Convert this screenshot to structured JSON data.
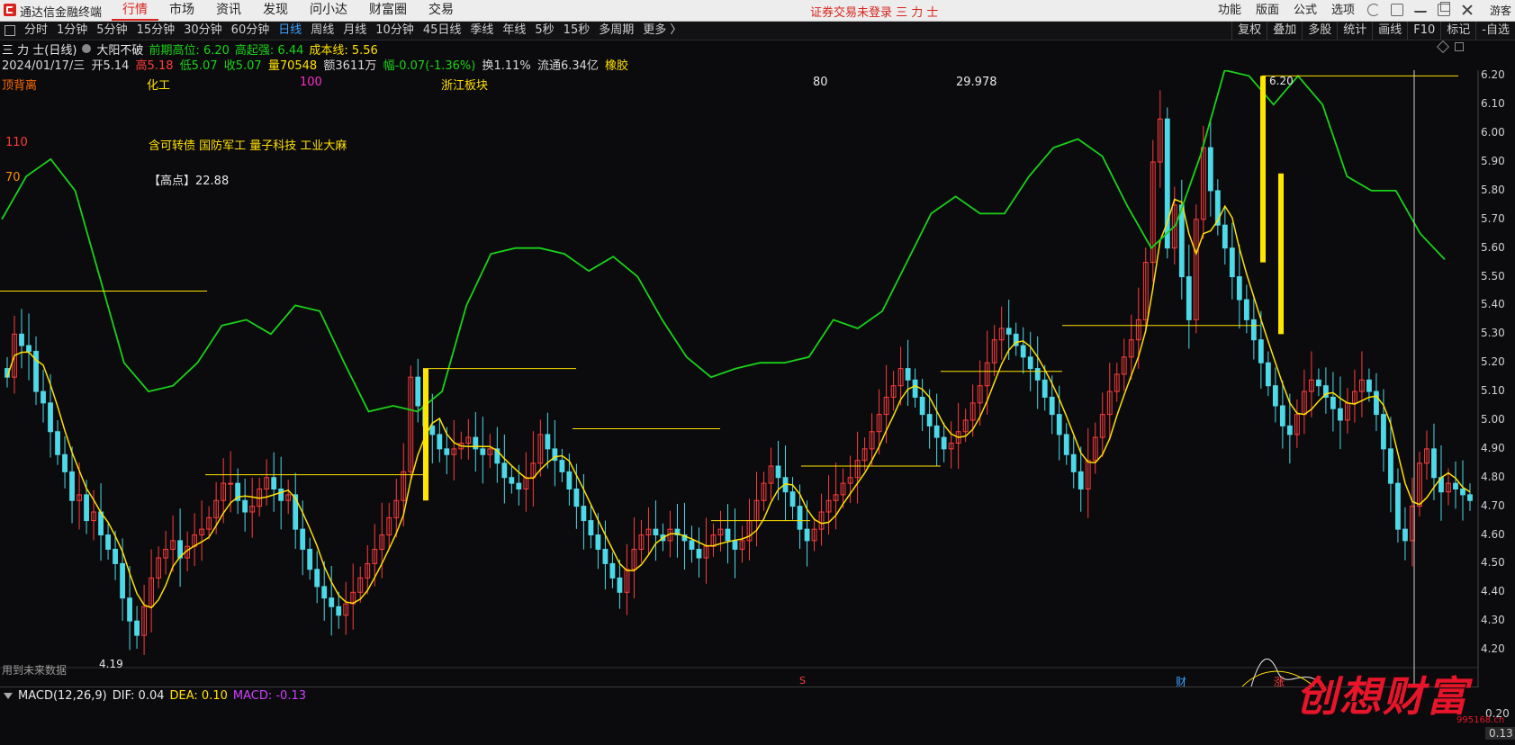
{
  "app": {
    "title": "通达信金融终端"
  },
  "menu": [
    "行情",
    "市场",
    "资讯",
    "发现",
    "问小达",
    "财富圈",
    "交易"
  ],
  "login_status": "证券交易未登录  三 力 士",
  "right_menu": [
    "功能",
    "版面",
    "公式",
    "选项"
  ],
  "guest_label": "游客",
  "periods": [
    "分时",
    "1分钟",
    "5分钟",
    "15分钟",
    "30分钟",
    "60分钟",
    "日线",
    "周线",
    "月线",
    "10分钟",
    "45日线",
    "季线",
    "年线",
    "5秒",
    "15秒",
    "多周期",
    "更多 〉"
  ],
  "active_period": "日线",
  "tools": [
    "复权",
    "叠加",
    "多股",
    "统计",
    "画线",
    "F10",
    "标记",
    "-自选"
  ],
  "stock": {
    "name": "三 力 士(日线)",
    "indicator": "大阳不破",
    "prev_high": "前期高位: 6.20",
    "strong": "高起强: 6.44",
    "cost": "成本线: 5.56"
  },
  "ohlc": {
    "date": "2024/01/17/三",
    "open": "开5.14",
    "high": "高5.18",
    "low": "低5.07",
    "close": "收5.07",
    "vol": "量70548",
    "amount": "额3611万",
    "change": "幅-0.07(-1.36%)",
    "turnover": "换1.11%",
    "float": "流通6.34亿",
    "sector": "橡胶"
  },
  "labels": {
    "top_div": "顶背离",
    "industry": "化工",
    "v100": "100",
    "region": "浙江板块",
    "v80": "80",
    "v29": "29.978",
    "v110": "110",
    "concepts": "含可转债  国防军工  量子科技  工业大麻",
    "v70": "70",
    "highpoint": "【高点】22.88",
    "future_data": "用到未来数据",
    "high_mark": "6.20",
    "low_mark": "4.19",
    "marker_s": "S",
    "marker_cai": "财",
    "marker_zhang": "涨"
  },
  "price_axis": [
    "6.20",
    "6.10",
    "6.00",
    "5.90",
    "5.80",
    "5.70",
    "5.60",
    "5.50",
    "5.40",
    "5.30",
    "5.20",
    "5.10",
    "5.00",
    "4.90",
    "4.80",
    "4.70",
    "4.60",
    "4.50",
    "4.40",
    "4.30",
    "4.20"
  ],
  "macd": {
    "name": "MACD(12,26,9)",
    "dif": "DIF: 0.04",
    "dea": "DEA: 0.10",
    "macd": "MACD: -0.13",
    "axis": [
      "0.20",
      "0.13"
    ]
  },
  "watermark": {
    "text": "创想财富",
    "url": "995168.cn"
  },
  "colors": {
    "up": "#ff3c3c",
    "down": "#4dd9e8",
    "ma": "#ffe000",
    "band": "#19d219",
    "hline": "#ffe000"
  },
  "chart_data": {
    "type": "candlestick",
    "ylim": [
      4.15,
      6.22
    ],
    "n_bars": 200,
    "close": [
      5.15,
      5.3,
      5.26,
      5.24,
      5.1,
      5.06,
      4.96,
      4.88,
      4.82,
      4.72,
      4.74,
      4.65,
      4.68,
      4.6,
      4.55,
      4.5,
      4.38,
      4.3,
      4.25,
      4.35,
      4.45,
      4.52,
      4.55,
      4.58,
      4.52,
      4.56,
      4.6,
      4.62,
      4.66,
      4.72,
      4.78,
      4.78,
      4.72,
      4.68,
      4.7,
      4.76,
      4.8,
      4.76,
      4.72,
      4.74,
      4.62,
      4.55,
      4.48,
      4.42,
      4.38,
      4.35,
      4.32,
      4.36,
      4.4,
      4.45,
      4.5,
      4.55,
      4.6,
      4.66,
      4.72,
      4.82,
      5.15,
      5.05,
      4.98,
      4.95,
      4.9,
      4.88,
      4.9,
      4.92,
      4.94,
      4.9,
      4.88,
      4.9,
      4.85,
      4.8,
      4.78,
      4.76,
      4.8,
      4.85,
      4.95,
      4.9,
      4.86,
      4.82,
      4.76,
      4.7,
      4.65,
      4.6,
      4.55,
      4.5,
      4.45,
      4.4,
      4.48,
      4.55,
      4.6,
      4.62,
      4.6,
      4.58,
      4.62,
      4.6,
      4.58,
      4.55,
      4.52,
      4.56,
      4.6,
      4.62,
      4.58,
      4.55,
      4.58,
      4.65,
      4.72,
      4.78,
      4.84,
      4.8,
      4.75,
      4.7,
      4.62,
      4.58,
      4.62,
      4.68,
      4.72,
      4.74,
      4.78,
      4.8,
      4.86,
      4.9,
      4.96,
      5.02,
      5.08,
      5.12,
      5.18,
      5.14,
      5.08,
      5.02,
      4.98,
      4.94,
      4.9,
      4.92,
      4.96,
      5.0,
      5.06,
      5.12,
      5.2,
      5.28,
      5.32,
      5.3,
      5.26,
      5.22,
      5.18,
      5.14,
      5.08,
      5.02,
      4.95,
      4.88,
      4.82,
      4.76,
      4.86,
      4.94,
      5.02,
      5.1,
      5.16,
      5.22,
      5.28,
      5.35,
      5.55,
      5.9,
      6.05,
      5.6,
      5.75,
      5.5,
      5.35,
      5.7,
      5.95,
      5.8,
      5.68,
      5.6,
      5.5,
      5.42,
      5.35,
      5.28,
      5.2,
      5.12,
      5.05,
      4.98,
      4.95,
      5.02,
      5.1,
      5.14,
      5.12,
      5.08,
      5.04,
      5.0,
      5.06,
      5.1,
      5.14,
      5.1,
      5.02,
      4.9,
      4.78,
      4.62,
      4.58,
      4.7,
      4.85,
      4.9,
      4.8,
      4.75,
      4.78,
      4.76,
      4.74,
      4.72
    ],
    "ma_series_name": "",
    "band_series": [
      5.7,
      5.85,
      5.91,
      5.8,
      5.5,
      5.2,
      5.1,
      5.12,
      5.2,
      5.33,
      5.35,
      5.3,
      5.4,
      5.38,
      5.2,
      5.03,
      5.05,
      5.03,
      5.1,
      5.4,
      5.58,
      5.6,
      5.6,
      5.58,
      5.52,
      5.57,
      5.5,
      5.35,
      5.22,
      5.15,
      5.18,
      5.2,
      5.2,
      5.22,
      5.35,
      5.32,
      5.38,
      5.55,
      5.72,
      5.78,
      5.72,
      5.72,
      5.85,
      5.95,
      5.98,
      5.92,
      5.75,
      5.6,
      5.68,
      5.92,
      6.3,
      6.2,
      6.1,
      6.2,
      6.1,
      5.85,
      5.8,
      5.8,
      5.65,
      5.56
    ]
  }
}
